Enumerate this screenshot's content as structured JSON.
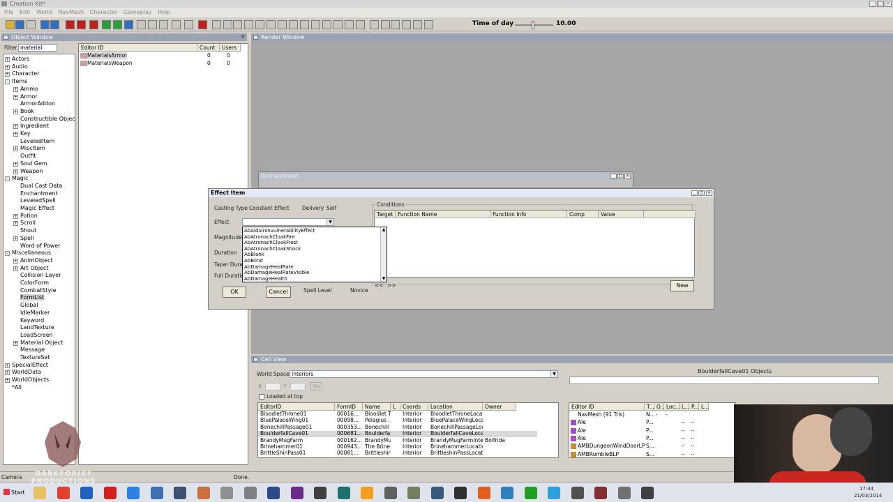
{
  "app": {
    "title": "Creation Kit*",
    "menu": [
      "File",
      "Edit",
      "World",
      "NavMesh",
      "Character",
      "Gameplay",
      "Help"
    ],
    "time_of_day_label": "Time of day",
    "time_of_day_value": "10.00"
  },
  "object_window": {
    "title": "Object Window",
    "filter_label": "Filter",
    "filter_value": "material",
    "tree": [
      {
        "label": "Actors",
        "level": 0,
        "exp": "+"
      },
      {
        "label": "Audio",
        "level": 0,
        "exp": "+"
      },
      {
        "label": "Character",
        "level": 0,
        "exp": "+"
      },
      {
        "label": "Items",
        "level": 0,
        "exp": "-"
      },
      {
        "label": "Ammo",
        "level": 1,
        "exp": "+"
      },
      {
        "label": "Armor",
        "level": 1,
        "exp": "+"
      },
      {
        "label": "ArmorAddon",
        "level": 1,
        "exp": ""
      },
      {
        "label": "Book",
        "level": 1,
        "exp": "+"
      },
      {
        "label": "Constructible Objec",
        "level": 1,
        "exp": ""
      },
      {
        "label": "Ingredient",
        "level": 1,
        "exp": "+"
      },
      {
        "label": "Key",
        "level": 1,
        "exp": "+"
      },
      {
        "label": "LeveledItem",
        "level": 1,
        "exp": ""
      },
      {
        "label": "MiscItem",
        "level": 1,
        "exp": "+"
      },
      {
        "label": "Outfit",
        "level": 1,
        "exp": ""
      },
      {
        "label": "Soul Gem",
        "level": 1,
        "exp": "+"
      },
      {
        "label": "Weapon",
        "level": 1,
        "exp": "+"
      },
      {
        "label": "Magic",
        "level": 0,
        "exp": "-"
      },
      {
        "label": "Dual Cast Data",
        "level": 1,
        "exp": ""
      },
      {
        "label": "Enchantment",
        "level": 1,
        "exp": ""
      },
      {
        "label": "LeveledSpell",
        "level": 1,
        "exp": ""
      },
      {
        "label": "Magic Effect",
        "level": 1,
        "exp": ""
      },
      {
        "label": "Potion",
        "level": 1,
        "exp": "+"
      },
      {
        "label": "Scroll",
        "level": 1,
        "exp": "+"
      },
      {
        "label": "Shout",
        "level": 1,
        "exp": ""
      },
      {
        "label": "Spell",
        "level": 1,
        "exp": "+"
      },
      {
        "label": "Word of Power",
        "level": 1,
        "exp": ""
      },
      {
        "label": "Miscellaneous",
        "level": 0,
        "exp": "-"
      },
      {
        "label": "AnimObject",
        "level": 1,
        "exp": "+"
      },
      {
        "label": "Art Object",
        "level": 1,
        "exp": "+"
      },
      {
        "label": "Collision Layer",
        "level": 1,
        "exp": ""
      },
      {
        "label": "ColorForm",
        "level": 1,
        "exp": ""
      },
      {
        "label": "CombatStyle",
        "level": 1,
        "exp": ""
      },
      {
        "label": "FormList",
        "level": 1,
        "exp": "",
        "selected": true
      },
      {
        "label": "Global",
        "level": 1,
        "exp": ""
      },
      {
        "label": "IdleMarker",
        "level": 1,
        "exp": ""
      },
      {
        "label": "Keyword",
        "level": 1,
        "exp": ""
      },
      {
        "label": "LandTexture",
        "level": 1,
        "exp": ""
      },
      {
        "label": "LoadScreen",
        "level": 1,
        "exp": ""
      },
      {
        "label": "Material Object",
        "level": 1,
        "exp": "+"
      },
      {
        "label": "Message",
        "level": 1,
        "exp": ""
      },
      {
        "label": "TextureSet",
        "level": 1,
        "exp": ""
      },
      {
        "label": "SpecialEffect",
        "level": 0,
        "exp": "+"
      },
      {
        "label": "WorldData",
        "level": 0,
        "exp": "+"
      },
      {
        "label": "WorldObjects",
        "level": 0,
        "exp": "+"
      },
      {
        "label": "*All",
        "level": 0,
        "exp": ""
      }
    ],
    "columns": [
      "Editor ID",
      "Count",
      "Users"
    ],
    "rows": [
      {
        "id": "MaterialsArmor",
        "count": "0",
        "users": "0"
      },
      {
        "id": "MaterialsWeapon",
        "count": "0",
        "users": "0"
      }
    ]
  },
  "render_window": {
    "title": "Render Window"
  },
  "enchantment": {
    "title": "Enchantment"
  },
  "effect_item": {
    "title": "Effect Item",
    "casting_type_label": "Casting Type",
    "casting_type_value": "Constant Effect",
    "delivery_label": "Delivery",
    "delivery_value": "Self",
    "effect_label": "Effect",
    "magnitude_label": "Magnitude",
    "duration_label": "Duration",
    "taper_duration_label": "Taper Durati",
    "full_duration_label": "Full Duration",
    "conditions_label": "Conditions",
    "condition_columns": [
      "Target",
      "Function Name",
      "Function Info",
      "Comp",
      "Value"
    ],
    "spell_level_label": "Spell Level",
    "spell_level_value": "Novice",
    "ok": "OK",
    "cancel": "Cancel",
    "new": "New",
    "nav_prev": "<<",
    "nav_next": ">>",
    "effect_options": [
      "AbAlduinInvulnerabilityEffect",
      "AbAtronachCloakFire",
      "AbAtronachCloakFrost",
      "AbAtronachCloakShock",
      "AbBlank",
      "AbBlind",
      "AbDamageHealRate",
      "AbDamageHealRateVisible",
      "AbDamageHealth"
    ]
  },
  "cell_view": {
    "title": "Cell View",
    "world_space_label": "World Space",
    "world_space_value": "Interiors",
    "x_label": "X",
    "y_label": "Y",
    "go": "Go",
    "loaded_at_top": "Loaded at top",
    "columns": [
      "EditorID",
      "FormID",
      "Name",
      "L",
      "Coords",
      "Location",
      "Owner"
    ],
    "rows": [
      [
        "BloodletThrone01",
        "00016...",
        "Bloodlet T...",
        "",
        "Interior",
        "BloodletThroneLocati...",
        ""
      ],
      [
        "BluePalaceWing01",
        "00098...",
        "Pelagius ...",
        "",
        "Interior",
        "BluePalaceWingLoca...",
        ""
      ],
      [
        "BonechillPassage01",
        "000353...",
        "Bonechill ...",
        "",
        "Interior",
        "BonechillPassageLoc...",
        ""
      ],
      [
        "BoulderfallCave01",
        "000681...",
        "Boulderfall...",
        "",
        "Interior",
        "BoulderfallCaveLocati...",
        ""
      ],
      [
        "BrandyMugFarm",
        "000162...",
        "BrandyMu...",
        "",
        "Interior",
        "BrandyMugFarmInteri...",
        "Bolfrida"
      ],
      [
        "Brinehammer01",
        "000943...",
        "The Brine...",
        "",
        "Interior",
        "BrinehammerLocation",
        ""
      ],
      [
        "BrittleShinPass01",
        "00081...",
        "Brittleshin...",
        "",
        "Interior",
        "BrittleshinPassLocation",
        ""
      ]
    ],
    "objects_title": "BoulderfallCave01 Objects",
    "obj_columns": [
      "Editor ID",
      "T...",
      "O...",
      "Loc...",
      "L...",
      "P...",
      "L..."
    ],
    "obj_rows": [
      [
        "NavMesh (91 Tris)",
        "N...",
        "-",
        "-",
        "",
        "",
        ""
      ],
      [
        "Ale",
        "P...",
        "",
        "",
        "--",
        "--",
        ""
      ],
      [
        "Ale",
        "P...",
        "",
        "",
        "--",
        "--",
        ""
      ],
      [
        "Ale",
        "P...",
        "",
        "",
        "--",
        "--",
        ""
      ],
      [
        "AMBDungeonWindDoorLP",
        "S...",
        "",
        "",
        "--",
        "--",
        ""
      ],
      [
        "AMBRumbleBLP",
        "S...",
        "",
        "",
        "--",
        "--",
        ""
      ]
    ]
  },
  "status": {
    "left": "Camera",
    "middle": "Done."
  },
  "taskbar": {
    "start": "Start",
    "time": "17:44",
    "date": "21/03/2014"
  },
  "watermark": {
    "line1": "DARKFOXIZ7",
    "line2": "PRODUCTIONS"
  },
  "colors": {
    "panel_title": "#9aa4b4",
    "render_bg": "#a6a6a6",
    "chrome": "#d4d0c8"
  }
}
